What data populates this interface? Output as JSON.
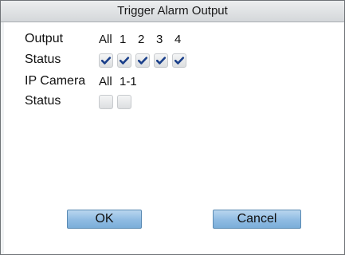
{
  "dialog": {
    "title": "Trigger Alarm Output",
    "output": {
      "label": "Output",
      "all_label": "All",
      "channels": [
        "1",
        "2",
        "3",
        "4"
      ]
    },
    "output_status": {
      "label": "Status",
      "all_checked": true,
      "channel_checked": [
        true,
        true,
        true,
        true
      ]
    },
    "ip_camera": {
      "label": "IP Camera",
      "all_label": "All",
      "channels": [
        "1-1"
      ]
    },
    "ip_camera_status": {
      "label": "Status",
      "all_checked": false,
      "channel_checked": [
        false
      ]
    },
    "ok_label": "OK",
    "cancel_label": "Cancel"
  },
  "colors": {
    "check": "#1a3f8a",
    "button_fill": "#8fbbe2"
  }
}
